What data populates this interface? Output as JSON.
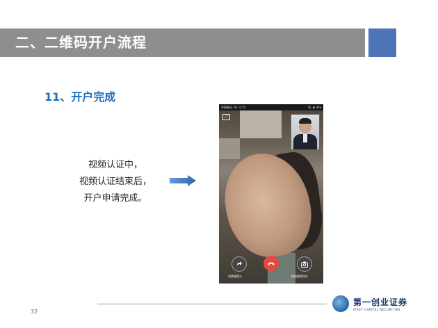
{
  "header": {
    "title": "二、二维码开户流程"
  },
  "step": {
    "title": "11、开户完成"
  },
  "description": {
    "lines": [
      "视频认证中，",
      "视频认证结束后，",
      "开户申请完成。"
    ]
  },
  "phone": {
    "status_left": "中国移动 4G 4:55",
    "status_right": "4G ■ 45%",
    "controls": {
      "switch_label": "切换摄像头",
      "camera_label": "拍照截图保存"
    }
  },
  "footer": {
    "page_number": "32",
    "logo_cn": "第一创业证券",
    "logo_en": "FIRST CAPITAL SECURITIES"
  },
  "colors": {
    "header_bg": "#8e8e8e",
    "accent": "#4e73b6",
    "subtitle": "#1f6fc0",
    "hangup": "#e24a3d"
  }
}
